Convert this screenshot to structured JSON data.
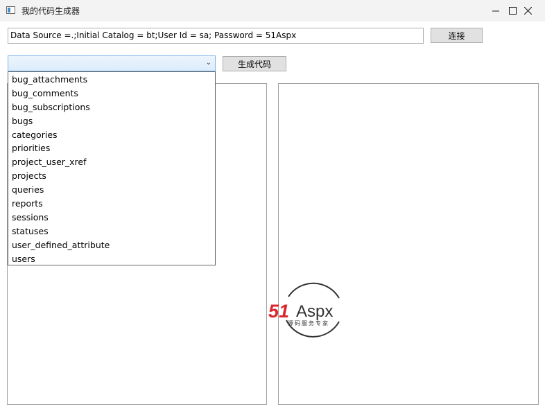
{
  "window": {
    "title": "我的代码生成器",
    "controls": [
      "minimize",
      "maximize",
      "close"
    ]
  },
  "connection": {
    "value": "Data Source =.;Initial Catalog = bt;User Id = sa; Password = 51Aspx",
    "connect_label": "连接"
  },
  "table_select": {
    "selected": "",
    "generate_label": "生成代码",
    "options": [
      "bug_attachments",
      "bug_comments",
      "bug_subscriptions",
      "bugs",
      "categories",
      "priorities",
      "project_user_xref",
      "projects",
      "queries",
      "reports",
      "sessions",
      "statuses",
      "user_defined_attribute",
      "users"
    ]
  },
  "watermark": {
    "brand_51": "51",
    "brand_aspx": "Aspx",
    "tagline": "源码服务专家",
    "colors": {
      "red": "#d9262c",
      "green": "#3aa84a",
      "dark": "#333333"
    }
  }
}
